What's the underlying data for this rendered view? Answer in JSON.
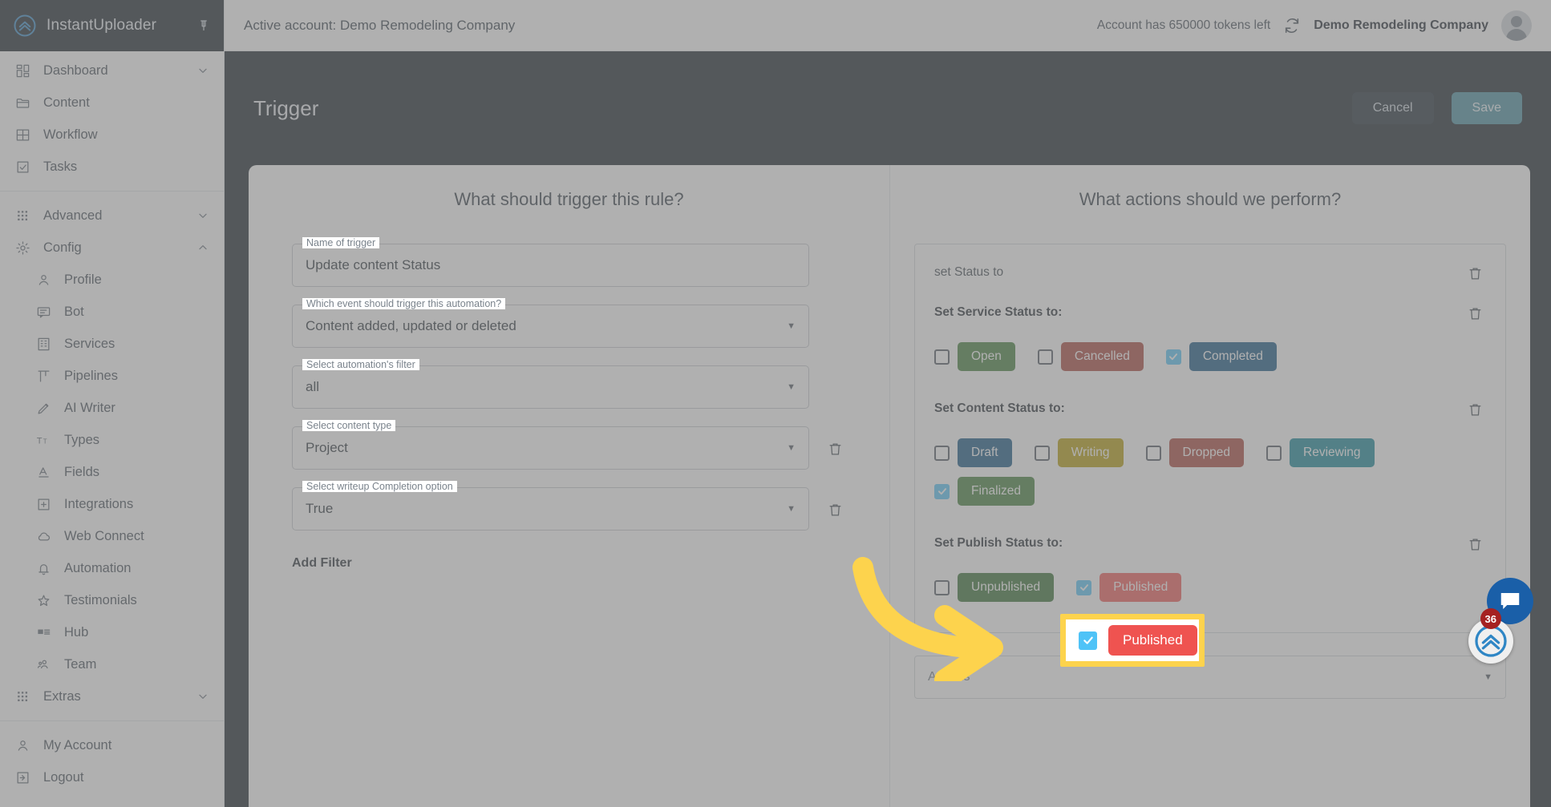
{
  "brand": {
    "name": "InstantUploader",
    "logo_icon": "chevrons-up-circle-icon",
    "pin_icon": "pin-icon"
  },
  "sidebar": {
    "groups": [
      {
        "items": [
          {
            "label": "Dashboard",
            "icon": "dashboard-grid-icon",
            "chevron": "chevron-down-icon",
            "sub": false
          },
          {
            "label": "Content",
            "icon": "folder-icon",
            "chevron": "",
            "sub": false
          },
          {
            "label": "Workflow",
            "icon": "table-icon",
            "chevron": "",
            "sub": false
          },
          {
            "label": "Tasks",
            "icon": "checkbox-icon",
            "chevron": "",
            "sub": false
          }
        ]
      },
      {
        "items": [
          {
            "label": "Advanced",
            "icon": "apps-grid-icon",
            "chevron": "chevron-down-icon",
            "sub": false
          },
          {
            "label": "Config",
            "icon": "gear-icon",
            "chevron": "chevron-up-icon",
            "sub": false
          },
          {
            "label": "Profile",
            "icon": "person-icon",
            "chevron": "",
            "sub": true
          },
          {
            "label": "Bot",
            "icon": "message-icon",
            "chevron": "",
            "sub": true
          },
          {
            "label": "Services",
            "icon": "building-icon",
            "chevron": "",
            "sub": true
          },
          {
            "label": "Pipelines",
            "icon": "pipeline-icon",
            "chevron": "",
            "sub": true
          },
          {
            "label": "AI Writer",
            "icon": "pencil-icon",
            "chevron": "",
            "sub": true
          },
          {
            "label": "Types",
            "icon": "text-format-icon",
            "chevron": "",
            "sub": true
          },
          {
            "label": "Fields",
            "icon": "font-size-icon",
            "chevron": "",
            "sub": true
          },
          {
            "label": "Integrations",
            "icon": "plus-square-icon",
            "chevron": "",
            "sub": true
          },
          {
            "label": "Web Connect",
            "icon": "cloud-icon",
            "chevron": "",
            "sub": true
          },
          {
            "label": "Automation",
            "icon": "bell-icon",
            "chevron": "",
            "sub": true
          },
          {
            "label": "Testimonials",
            "icon": "star-icon",
            "chevron": "",
            "sub": true
          },
          {
            "label": "Hub",
            "icon": "article-icon",
            "chevron": "",
            "sub": true
          },
          {
            "label": "Team",
            "icon": "group-icon",
            "chevron": "",
            "sub": true
          },
          {
            "label": "Extras",
            "icon": "apps-grid-icon",
            "chevron": "chevron-down-icon",
            "sub": false
          }
        ]
      },
      {
        "items": [
          {
            "label": "My Account",
            "icon": "person-icon",
            "chevron": "",
            "sub": false
          },
          {
            "label": "Logout",
            "icon": "logout-icon",
            "chevron": "",
            "sub": false
          }
        ]
      }
    ]
  },
  "topbar": {
    "active_account": "Active account: Demo Remodeling Company",
    "tokens": "Account has 650000 tokens left",
    "refresh_icon": "refresh-icon",
    "account_name": "Demo Remodeling Company",
    "avatar_icon": "avatar-icon"
  },
  "pagehead": {
    "title": "Trigger",
    "cancel_label": "Cancel",
    "save_label": "Save"
  },
  "trigger_panel": {
    "heading": "What should trigger this rule?",
    "fields": [
      {
        "legend": "Name of trigger",
        "value": "Update content Status",
        "type": "text",
        "has_trash": false
      },
      {
        "legend": "Which event should trigger this automation?",
        "value": "Content added, updated or deleted",
        "type": "select",
        "has_trash": false
      },
      {
        "legend": "Select automation's filter",
        "value": "all",
        "type": "select",
        "has_trash": false
      },
      {
        "legend": "Select content type",
        "value": "Project",
        "type": "select",
        "has_trash": true
      },
      {
        "legend": "Select writeup Completion option",
        "value": "True",
        "type": "select",
        "has_trash": true
      }
    ],
    "add_filter_label": "Add Filter"
  },
  "actions_panel": {
    "heading": "What actions should we perform?",
    "action_label": "set Status to",
    "trash_icon": "trash-icon",
    "status_groups": [
      {
        "label": "Set Service Status to:",
        "chips": [
          {
            "label": "Open",
            "color": "#3a7a33",
            "checked": false
          },
          {
            "label": "Cancelled",
            "color": "#a63d34",
            "checked": false
          },
          {
            "label": "Completed",
            "color": "#0b4f7e",
            "checked": true
          }
        ]
      },
      {
        "label": "Set Content Status to:",
        "chips": [
          {
            "label": "Draft",
            "color": "#0b4f7e",
            "checked": false
          },
          {
            "label": "Writing",
            "color": "#b39800",
            "checked": false
          },
          {
            "label": "Dropped",
            "color": "#a63d34",
            "checked": false
          },
          {
            "label": "Reviewing",
            "color": "#0d8193",
            "checked": false
          },
          {
            "label": "Finalized",
            "color": "#3a7a33",
            "checked": true
          }
        ]
      },
      {
        "label": "Set Publish Status to:",
        "chips": [
          {
            "label": "Unpublished",
            "color": "#2e6b2a",
            "checked": false
          },
          {
            "label": "Published",
            "color": "#ef5350",
            "checked": true
          }
        ]
      }
    ],
    "actions_select_placeholder": "Actions",
    "caret_icon": "chevron-down-icon"
  },
  "highlight": {
    "checkbox_checked": true,
    "chip_label": "Published",
    "border_color": "#fdd34d",
    "chip_color": "#ef5350",
    "checkbox_color": "#4fc3f7",
    "arrow_color": "#fdd34d"
  },
  "chat_widget": {
    "bubble_icon": "chat-bubble-icon",
    "badge_count": "36",
    "fab_icon": "chevrons-up-circle-icon",
    "bubble_color": "#1a5fa8",
    "badge_color": "#a52121"
  }
}
